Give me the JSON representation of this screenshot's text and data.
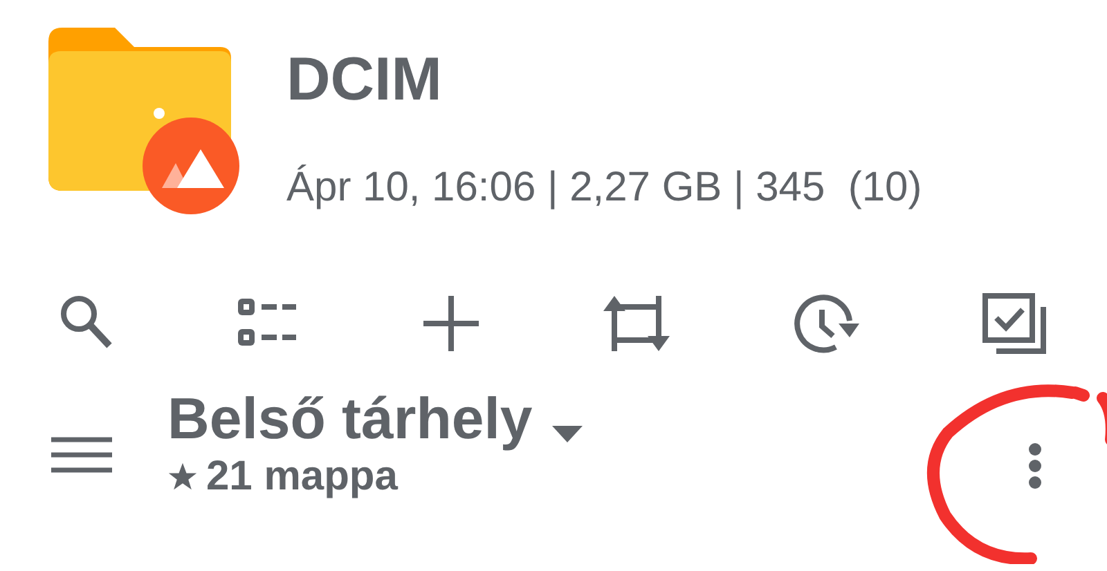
{
  "folder": {
    "name": "DCIM",
    "info": "Ápr 10, 16:06 | 2,27 GB | 345  (10)"
  },
  "toolbar": [
    {
      "kind": "search"
    },
    {
      "kind": "select"
    },
    {
      "kind": "add"
    },
    {
      "kind": "sync"
    },
    {
      "kind": "history"
    },
    {
      "kind": "check"
    }
  ],
  "location": {
    "title": "Belső tárhely",
    "subtitle": "21 mappa",
    "starred": true
  }
}
